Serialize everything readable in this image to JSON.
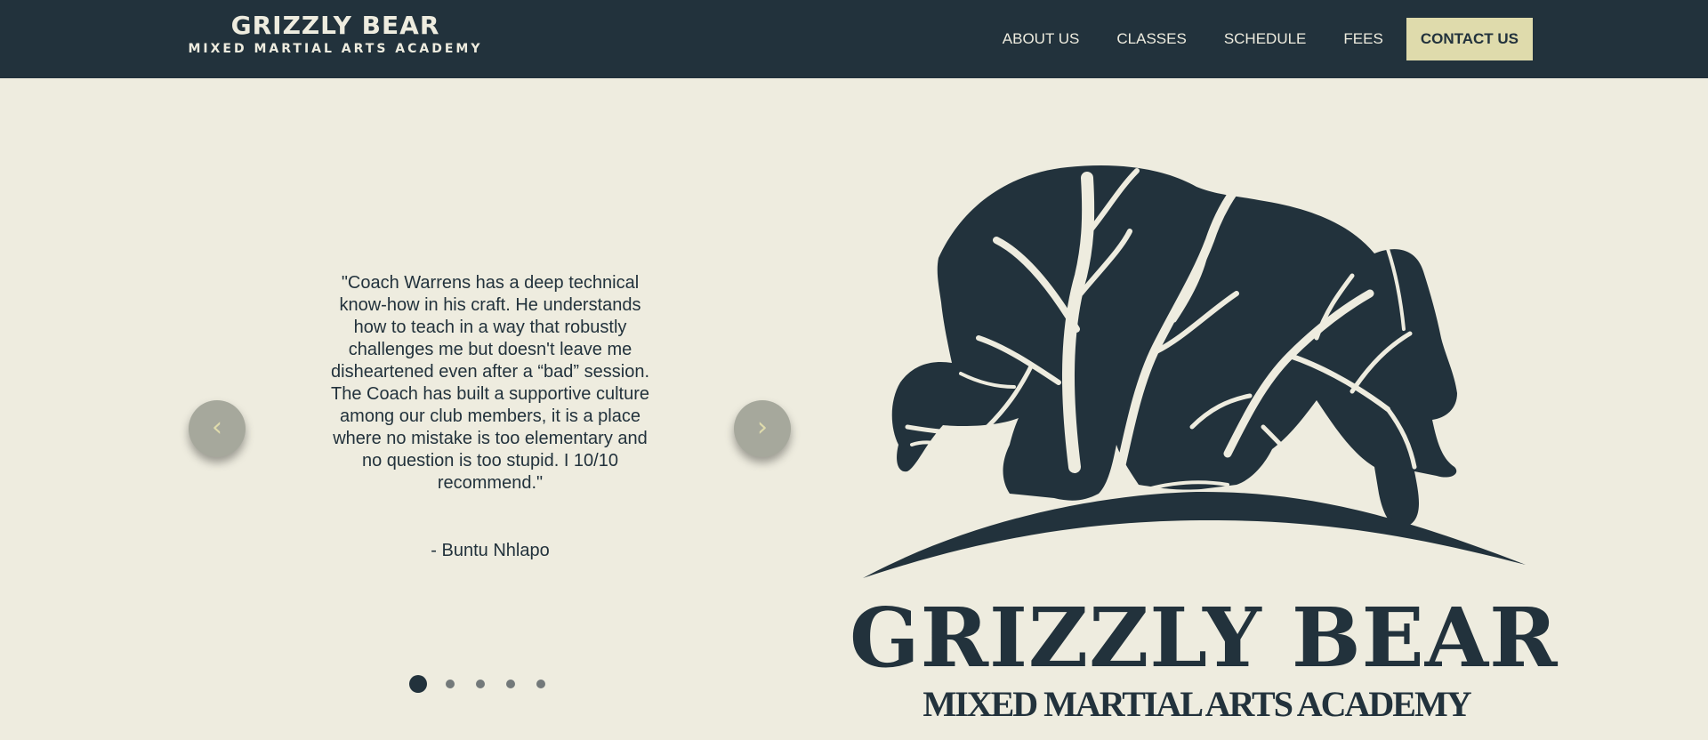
{
  "header": {
    "brand_name": "GRIZZLY BEAR",
    "brand_tagline": "MIXED MARTIAL ARTS ACADEMY",
    "nav": [
      "ABOUT US",
      "CLASSES",
      "SCHEDULE",
      "FEES"
    ],
    "cta_label": "CONTACT US"
  },
  "testimonial": {
    "quote": "\"Coach Warrens has a deep technical know-how in his craft. He understands how to teach in a way that robustly challenges me but doesn't leave me disheartened even after a “bad” session. The Coach has built a supportive culture among our club members, it is a place where no mistake is too elementary and no question is too stupid. I 10/10 recommend.\"",
    "author": "- Buntu Nhlapo",
    "prev_icon": "‹",
    "next_icon": "›",
    "slide_count": 5,
    "active_slide": 1
  },
  "logo": {
    "title": "GRIZZLY BEAR",
    "subtitle": "MIXED MARTIAL ARTS ACADEMY",
    "icon": "bear-tree-icon"
  },
  "colors": {
    "dark": "#22323c",
    "background": "#eeecdf",
    "accent": "#dfdbac"
  }
}
